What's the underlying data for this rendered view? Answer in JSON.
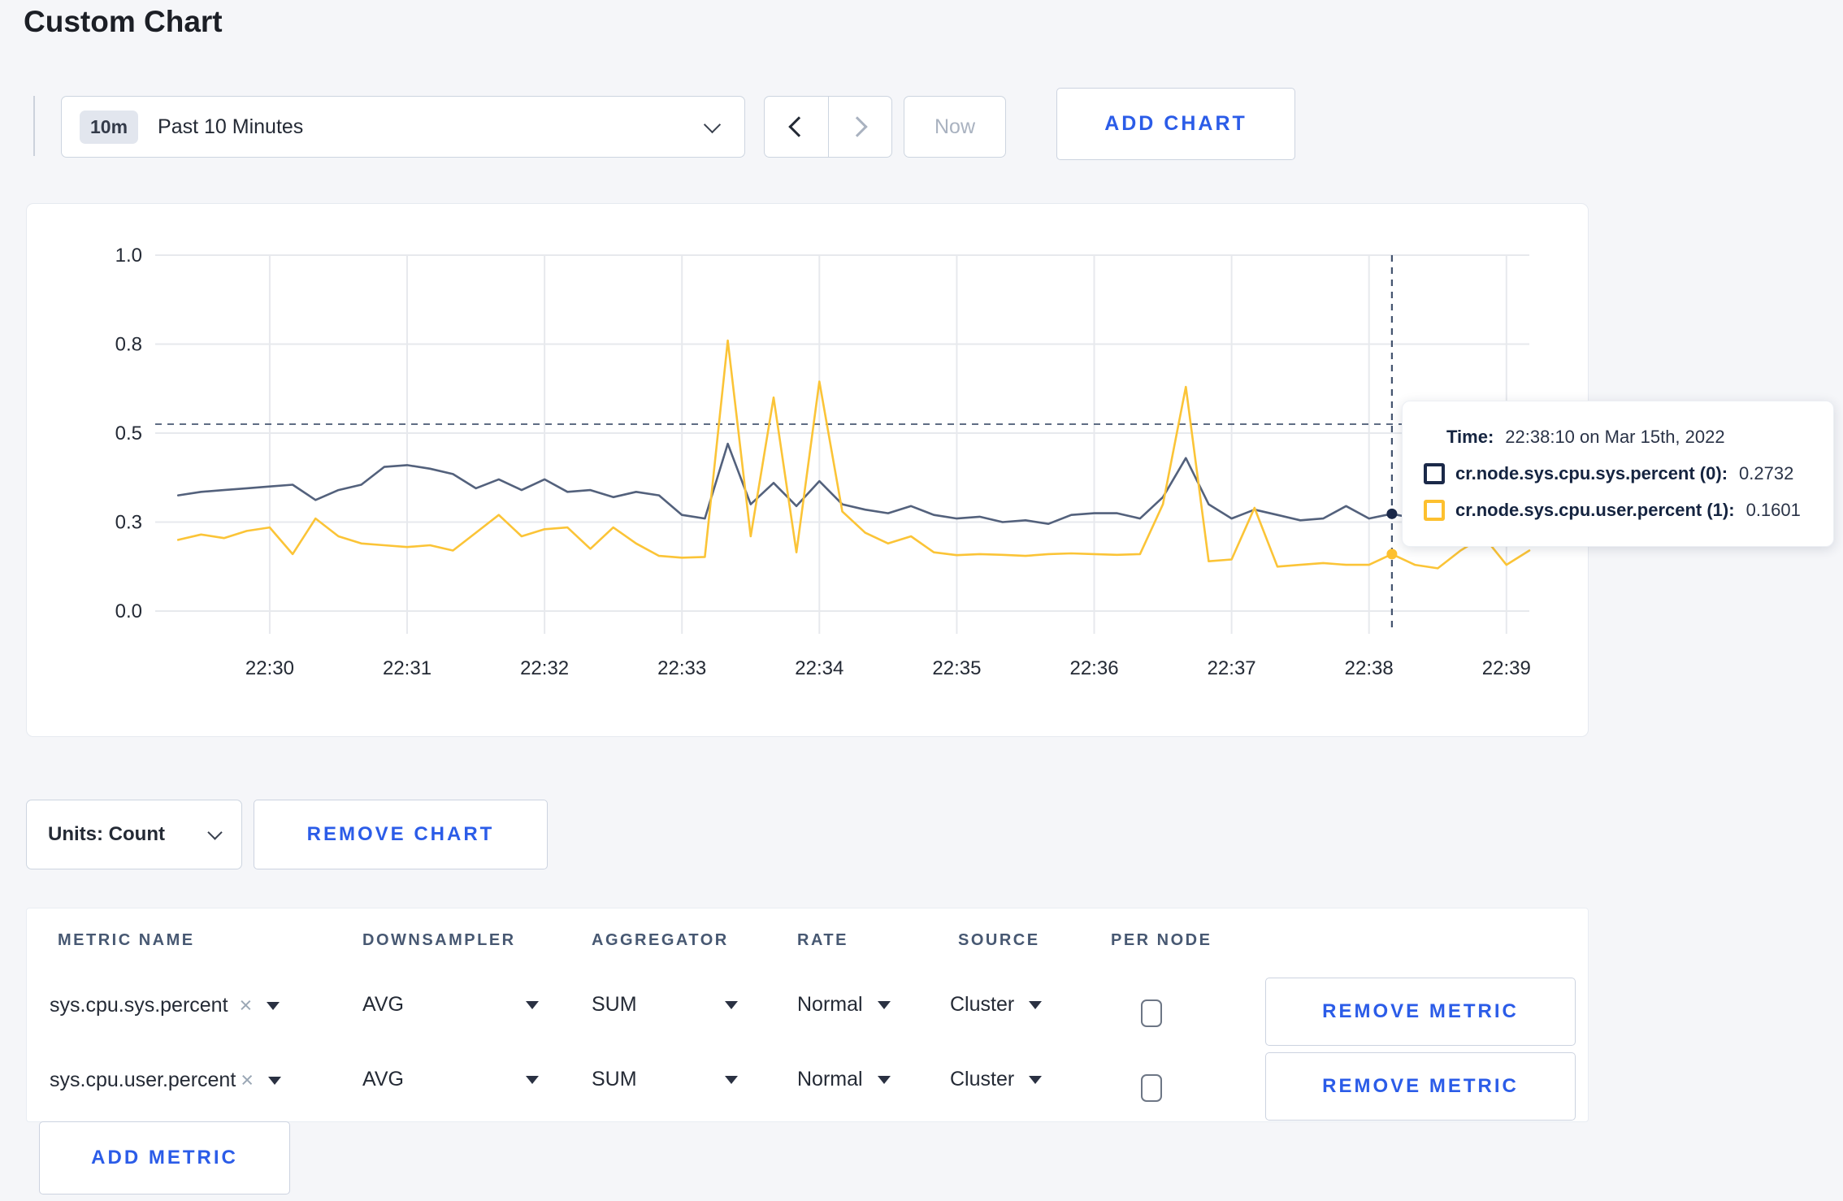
{
  "page": {
    "title": "Custom Chart"
  },
  "toolbar": {
    "time_scale": {
      "badge": "10m",
      "label": "Past 10 Minutes"
    },
    "now_label": "Now",
    "add_chart_label": "ADD CHART"
  },
  "chart_data": {
    "type": "line",
    "ylim": [
      0,
      1
    ],
    "grid": true,
    "x_start_s": 10,
    "x_step_s": 10,
    "x_ticks": [
      {
        "s": 50,
        "label": "22:30"
      },
      {
        "s": 110,
        "label": "22:31"
      },
      {
        "s": 170,
        "label": "22:32"
      },
      {
        "s": 230,
        "label": "22:33"
      },
      {
        "s": 290,
        "label": "22:34"
      },
      {
        "s": 350,
        "label": "22:35"
      },
      {
        "s": 410,
        "label": "22:36"
      },
      {
        "s": 470,
        "label": "22:37"
      },
      {
        "s": 530,
        "label": "22:38"
      },
      {
        "s": 590,
        "label": "22:39"
      }
    ],
    "y_ticks": [
      {
        "v": 0,
        "label": "0.0"
      },
      {
        "v": 0.25,
        "label": "0.3"
      },
      {
        "v": 0.5,
        "label": "0.5"
      },
      {
        "v": 0.75,
        "label": "0.8"
      },
      {
        "v": 1,
        "label": "1.0"
      }
    ],
    "series": [
      {
        "name": "cr.node.sys.cpu.sys.percent",
        "color": "#53617c",
        "values": [
          0.325,
          0.335,
          0.34,
          0.345,
          0.35,
          0.355,
          0.312,
          0.34,
          0.355,
          0.405,
          0.41,
          0.4,
          0.385,
          0.345,
          0.37,
          0.34,
          0.37,
          0.335,
          0.34,
          0.32,
          0.335,
          0.325,
          0.27,
          0.26,
          0.47,
          0.3,
          0.36,
          0.295,
          0.365,
          0.3,
          0.285,
          0.275,
          0.295,
          0.27,
          0.26,
          0.265,
          0.25,
          0.255,
          0.245,
          0.27,
          0.275,
          0.275,
          0.26,
          0.32,
          0.43,
          0.3,
          0.26,
          0.285,
          0.27,
          0.255,
          0.26,
          0.295,
          0.26,
          0.2732,
          0.26,
          0.27,
          0.28,
          0.29,
          0.295,
          0.3
        ]
      },
      {
        "name": "cr.node.sys.cpu.user.percent",
        "color": "#fbc437",
        "values": [
          0.2,
          0.215,
          0.205,
          0.225,
          0.235,
          0.16,
          0.26,
          0.21,
          0.19,
          0.185,
          0.18,
          0.185,
          0.17,
          0.22,
          0.27,
          0.21,
          0.23,
          0.235,
          0.175,
          0.235,
          0.19,
          0.155,
          0.15,
          0.152,
          0.76,
          0.21,
          0.6,
          0.165,
          0.645,
          0.28,
          0.22,
          0.19,
          0.21,
          0.165,
          0.157,
          0.16,
          0.158,
          0.155,
          0.16,
          0.162,
          0.16,
          0.158,
          0.16,
          0.3,
          0.63,
          0.14,
          0.145,
          0.29,
          0.125,
          0.13,
          0.135,
          0.13,
          0.13,
          0.1601,
          0.13,
          0.12,
          0.17,
          0.21,
          0.13,
          0.17
        ]
      }
    ],
    "crosshair": {
      "x_s": 540,
      "h_value": 0.525,
      "color": "#44546f"
    },
    "hover_points": [
      {
        "series": 0,
        "value": 0.2732,
        "color": "#1b2949"
      },
      {
        "series": 1,
        "value": 0.1601,
        "color": "#fdc02f"
      }
    ]
  },
  "tooltip": {
    "time_label": "Time:",
    "time_value": "22:38:10 on Mar 15th, 2022",
    "series": [
      {
        "swatch_color": "#1b2949",
        "label": "cr.node.sys.cpu.sys.percent (0):",
        "value": "0.2732"
      },
      {
        "swatch_color": "#fdc02f",
        "label": "cr.node.sys.cpu.user.percent (1):",
        "value": "0.1601"
      }
    ]
  },
  "chart_controls": {
    "units_label": "Units: Count",
    "remove_chart_label": "REMOVE CHART"
  },
  "metrics_table": {
    "headers": [
      "METRIC NAME",
      "DOWNSAMPLER",
      "AGGREGATOR",
      "RATE",
      "SOURCE",
      "PER NODE"
    ],
    "rows": [
      {
        "metric": "sys.cpu.sys.percent",
        "downsampler": "AVG",
        "aggregator": "SUM",
        "rate": "Normal",
        "source": "Cluster",
        "per_node_checked": false,
        "remove_label": "REMOVE METRIC"
      },
      {
        "metric": "sys.cpu.user.percent",
        "downsampler": "AVG",
        "aggregator": "SUM",
        "rate": "Normal",
        "source": "Cluster",
        "per_node_checked": false,
        "remove_label": "REMOVE METRIC"
      }
    ],
    "add_metric_label": "ADD METRIC"
  },
  "icons": {
    "clear_x": "×"
  },
  "colors": {
    "accent_blue": "#2b5ce8",
    "sys_line": "#53617c",
    "user_line": "#fbc437",
    "sys_swatch": "#1b2949",
    "user_swatch": "#fdc02f"
  }
}
